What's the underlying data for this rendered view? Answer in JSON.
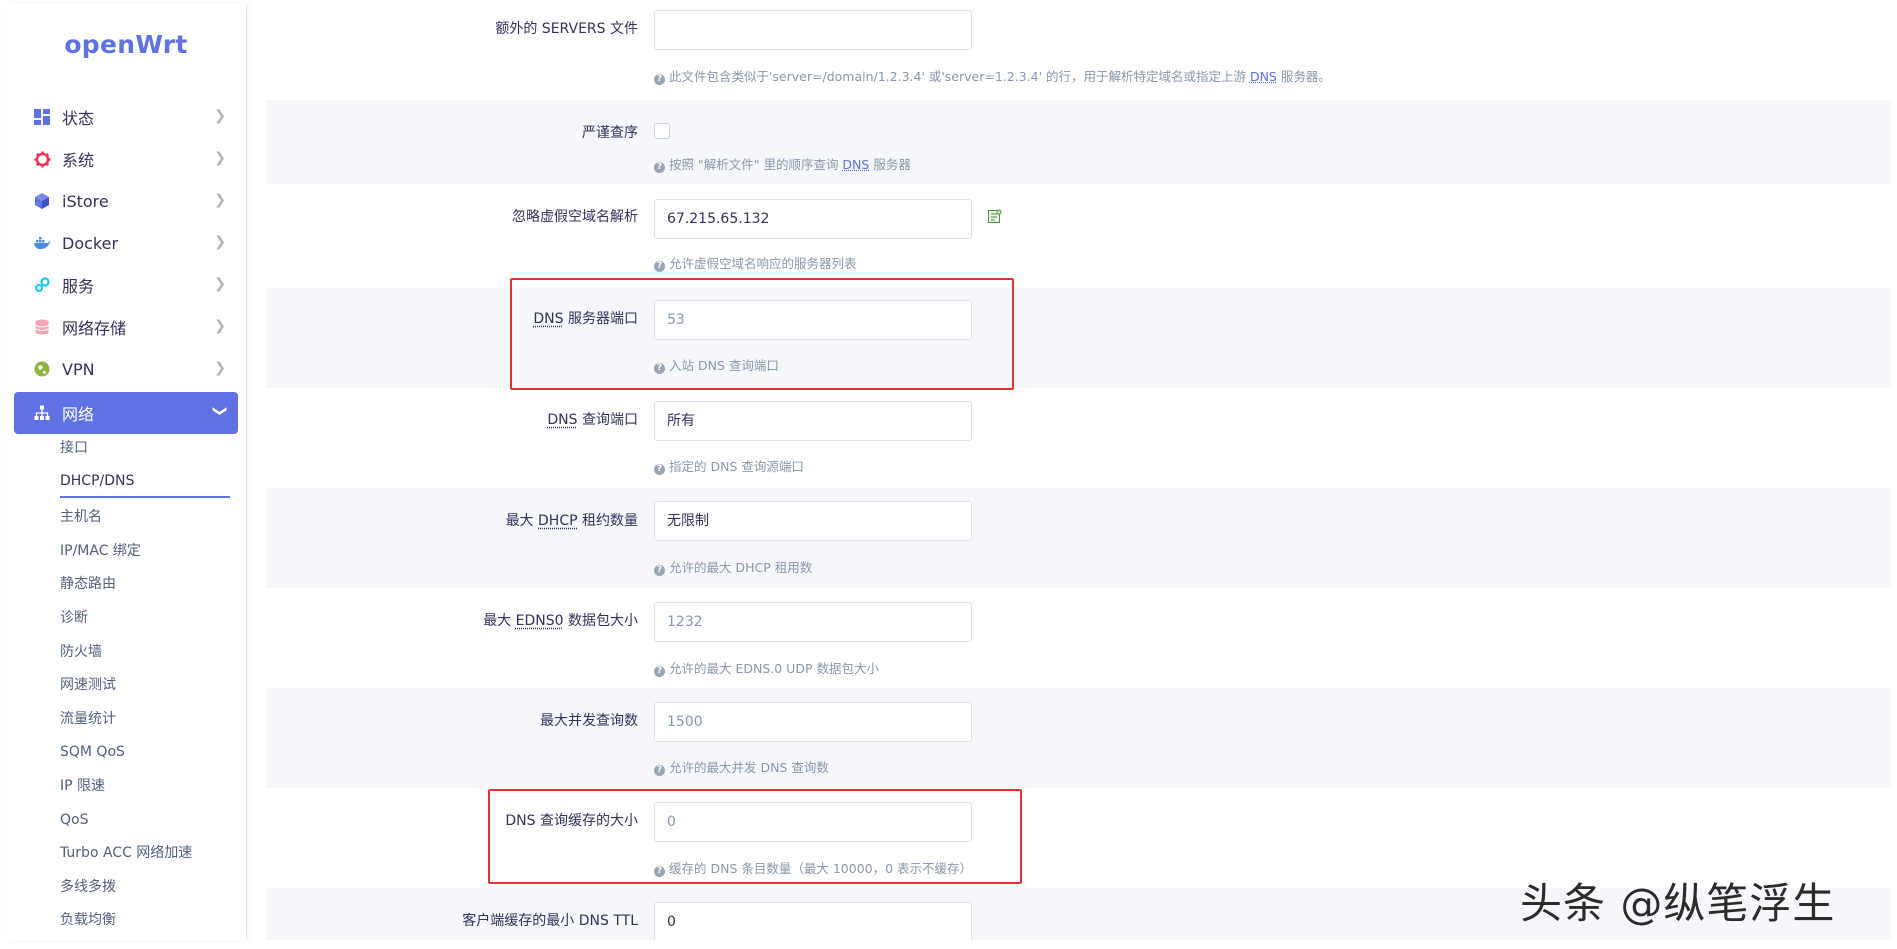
{
  "app": {
    "logo": "openWrt"
  },
  "sidebar": {
    "items": [
      {
        "label": "状态",
        "icon": "dashboard-icon"
      },
      {
        "label": "系统",
        "icon": "gear-icon"
      },
      {
        "label": "iStore",
        "icon": "cube-icon"
      },
      {
        "label": "Docker",
        "icon": "docker-icon"
      },
      {
        "label": "服务",
        "icon": "services-icon"
      },
      {
        "label": "网络存储",
        "icon": "database-icon"
      },
      {
        "label": "VPN",
        "icon": "vpn-icon"
      },
      {
        "label": "网络",
        "icon": "network-icon",
        "active": true
      }
    ],
    "subitems": [
      {
        "label": "接口"
      },
      {
        "label": "DHCP/DNS",
        "active": true
      },
      {
        "label": "主机名"
      },
      {
        "label": "IP/MAC 绑定"
      },
      {
        "label": "静态路由"
      },
      {
        "label": "诊断"
      },
      {
        "label": "防火墙"
      },
      {
        "label": "网速测试"
      },
      {
        "label": "流量统计"
      },
      {
        "label": "SQM QoS"
      },
      {
        "label": "IP 限速"
      },
      {
        "label": "QoS"
      },
      {
        "label": "Turbo ACC 网络加速"
      },
      {
        "label": "多线多拨"
      },
      {
        "label": "负载均衡"
      }
    ]
  },
  "form": {
    "extra_servers": {
      "label": "额外的 SERVERS 文件",
      "value": "",
      "hint_pre": "此文件包含类似于'server=/domain/1.2.3.4' 或'server=1.2.3.4' 的行，用于解析特定域名或指定上游 ",
      "hint_link": "DNS",
      "hint_post": " 服务器。"
    },
    "strict_order": {
      "label": "严谨查序",
      "checked": false,
      "hint_pre": "按照 \"解析文件\" 里的顺序查询 ",
      "hint_link": "DNS",
      "hint_post": " 服务器"
    },
    "bogus_nx": {
      "label": "忽略虚假空域名解析",
      "value": "67.215.65.132",
      "hint": "允许虚假空域名响应的服务器列表"
    },
    "dns_port": {
      "label_abbr": "DNS",
      "label_rest": " 服务器端口",
      "placeholder": "53",
      "hint": "入站 DNS 查询端口"
    },
    "query_port": {
      "label_abbr": "DNS",
      "label_rest": " 查询端口",
      "value": "所有",
      "hint": "指定的 DNS 查询源端口"
    },
    "dhcp_leases": {
      "label_pre": "最大 ",
      "label_abbr": "DHCP",
      "label_post": " 租约数量",
      "value": "无限制",
      "hint": "允许的最大 DHCP 租用数"
    },
    "edns_size": {
      "label_pre": "最大 ",
      "label_abbr": "EDNS0",
      "label_post": " 数据包大小",
      "placeholder": "1232",
      "hint": "允许的最大 EDNS.0 UDP 数据包大小"
    },
    "max_concurrent": {
      "label": "最大并发查询数",
      "placeholder": "1500",
      "hint": "允许的最大并发 DNS 查询数"
    },
    "cache_size": {
      "label": "DNS 查询缓存的大小",
      "placeholder": "0",
      "hint": "缓存的 DNS 条目数量（最大 10000，0 表示不缓存）"
    },
    "min_ttl": {
      "label": "客户端缓存的最小 DNS TTL",
      "value": "0"
    }
  },
  "watermark": "头条 @纵笔浮生",
  "colors": {
    "accent": "#5e72e4",
    "highlight": "#e03434"
  }
}
